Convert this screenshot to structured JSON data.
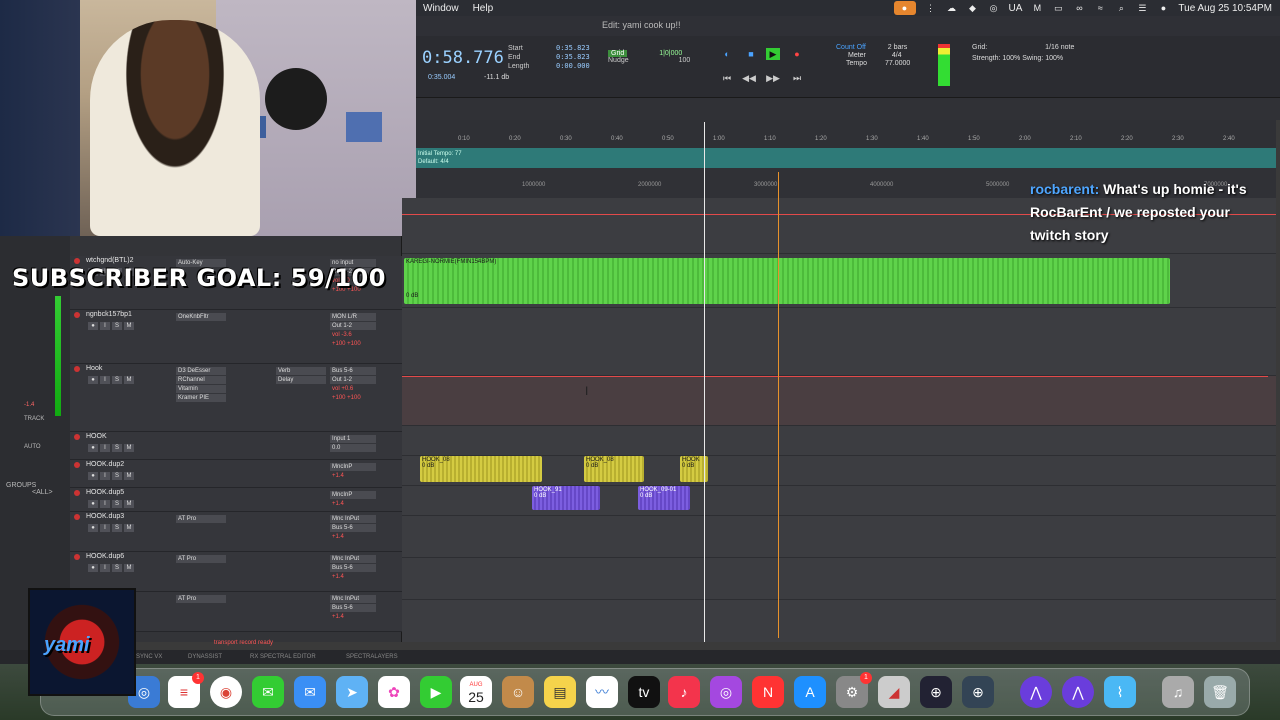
{
  "overlay": {
    "subscriber_goal": "SUBSCRIBER GOAL: 59/100",
    "chat_user": "rocbarent:",
    "chat_message": "What's up homie - it's RocBarEnt / we reposted your twitch story",
    "logo_text": "yami"
  },
  "menubar": {
    "items": [
      "Window",
      "Help"
    ],
    "lang": "UA",
    "datetime": "Tue Aug 25  10:54PM"
  },
  "window": {
    "title": "Edit: yami cook up!!"
  },
  "transport": {
    "counter": "0:58.776",
    "start_label": "Start",
    "end_label": "End",
    "length_label": "Length",
    "start_val": "0:35.823",
    "end_val": "0:35.823",
    "length_val": "0:00.000",
    "pre_val": "0:35.004",
    "db_val": "-11.1 db",
    "grid_label": "Grid",
    "grid_val": "1|0|000",
    "nudge_label": "Nudge",
    "nudge_val": "100",
    "count_off": "Count Off",
    "meter": "Meter",
    "tempo": "Tempo",
    "bars": "2 bars",
    "meter_val": "4/4",
    "tempo_val": "77.0000",
    "grid_panel": "Grid:",
    "grid_note": "1/16 note",
    "strength": "Strength:",
    "strength_val": "100%",
    "swing": "Swing:",
    "swing_val": "100%"
  },
  "ruler": {
    "time_ticks": [
      "0:10",
      "0:20",
      "0:30",
      "0:40",
      "0:50",
      "1:00",
      "1:10",
      "1:20",
      "1:30",
      "1:40",
      "1:50",
      "2:00",
      "2:10",
      "2:20",
      "2:30",
      "2:40"
    ],
    "tempo_label": "Initial Tempo: 77",
    "meter_label": "Default: 4/4",
    "sample_ticks": [
      "1000000",
      "2000000",
      "3000000",
      "4000000",
      "5000000",
      "7000000"
    ]
  },
  "mixer": {
    "db": "-1.4",
    "track_label": "TRACK",
    "auto_label": "AUTO",
    "groups": "GROUPS",
    "all": "<ALL>"
  },
  "tracks": [
    {
      "name": "wtchgnd(BTL)2",
      "inserts": [
        "Auto-Key"
      ],
      "io": [
        "no input",
        "Out 1-2",
        "vol  0.0",
        "+100  +100"
      ]
    },
    {
      "name": "ngnbck157bp1",
      "inserts": [
        "OneKnbFltr"
      ],
      "io": [
        "MON L/R",
        "Out 1-2",
        "vol  -3.6",
        "+100  +100"
      ]
    },
    {
      "name": "Hook",
      "inserts": [
        "D3 DeEsser",
        "RChannel",
        "Vitamin",
        "Kramer PIE"
      ],
      "sends": [
        "Verb",
        "Delay"
      ],
      "io": [
        "Bus 5-6",
        "Out 1-2",
        "vol  +0.6",
        "+100  +100"
      ]
    },
    {
      "name": "HOOK",
      "inserts": [],
      "io": [
        "Input 1",
        "0.0"
      ]
    },
    {
      "name": "HOOK.dup2",
      "inserts": [],
      "io": [
        "MncInP",
        "+1.4"
      ]
    },
    {
      "name": "HOOK.dup5",
      "inserts": [],
      "io": [
        "MncInP",
        "+1.4"
      ]
    },
    {
      "name": "HOOK.dup3",
      "inserts": [
        "AT Pro"
      ],
      "io": [
        "Mnc InPut",
        "Bus 5-6",
        "+1.4"
      ]
    },
    {
      "name": "HOOK.dup6",
      "inserts": [
        "AT Pro"
      ],
      "io": [
        "Mnc InPut",
        "Bus 5-6",
        "+1.4"
      ]
    },
    {
      "name": "",
      "inserts": [
        "AT Pro"
      ],
      "io": [
        "Mnc InPut",
        "Bus 5-6",
        "+1.4"
      ]
    }
  ],
  "clips": {
    "beat": "KAREGI-NORMIE(FMIN154BPM)",
    "beat_db": "0 dB",
    "hook1": "HOOK_08",
    "hook2": "HOOK_08",
    "hook3": "HOOK",
    "hook4": "HOOK_91",
    "hook5": "HOOK_09-01",
    "db": "0 dB"
  },
  "bottom": {
    "tabs": [
      "SYNC VX",
      "DYNASSIST",
      "RX SPECTRAL EDITOR",
      "SPECTRALAYERS"
    ],
    "transport_note": "transport record ready"
  },
  "dock": {
    "date_month": "AUG",
    "date_day": "25",
    "badge1": "1",
    "badge2": "1"
  }
}
